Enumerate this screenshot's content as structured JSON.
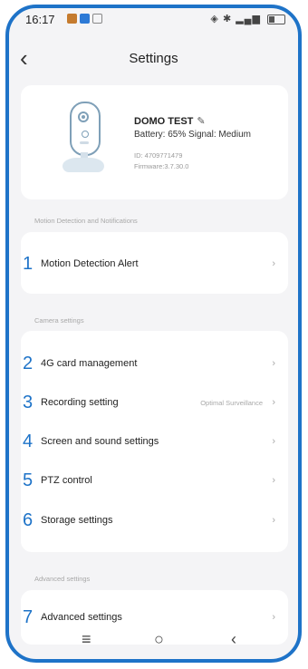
{
  "status_bar": {
    "time": "16:17",
    "colors": [
      "#c57b2e",
      "#2d7ad6",
      "#888888"
    ]
  },
  "header": {
    "title": "Settings"
  },
  "device": {
    "name": "DOMO TEST",
    "battery_label": "Battery:",
    "battery_value": "65%",
    "signal_label": "Signal:",
    "signal_value": "Medium",
    "id": "ID: 4709771479",
    "firmware": "Firmware:3.7.30.0"
  },
  "sections": {
    "motion": "Motion Detection and Notifications",
    "camera": "Camera settings",
    "advanced": "Advanced settings"
  },
  "rows": [
    {
      "num": "1",
      "label": "Motion Detection Alert",
      "value": ""
    },
    {
      "num": "2",
      "label": "4G card management",
      "value": ""
    },
    {
      "num": "3",
      "label": "Recording setting",
      "value": "Optimal Surveillance"
    },
    {
      "num": "4",
      "label": "Screen and sound settings",
      "value": ""
    },
    {
      "num": "5",
      "label": "PTZ control",
      "value": ""
    },
    {
      "num": "6",
      "label": "Storage settings",
      "value": ""
    },
    {
      "num": "7",
      "label": "Advanced settings",
      "value": ""
    }
  ],
  "accent_color": "#1e73c8"
}
